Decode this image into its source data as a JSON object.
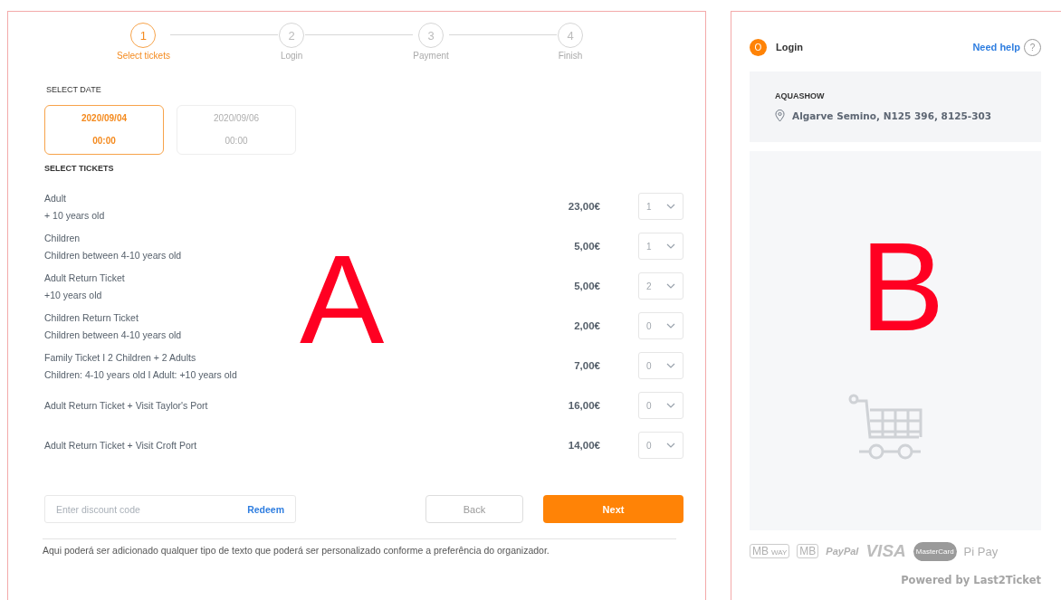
{
  "steps": [
    {
      "number": "1",
      "label": "Select tickets",
      "selected": true
    },
    {
      "number": "2",
      "label": "Login",
      "selected": false
    },
    {
      "number": "3",
      "label": "Payment",
      "selected": false
    },
    {
      "number": "4",
      "label": "Finish",
      "selected": false
    }
  ],
  "date_section": {
    "title": "SELECT DATE",
    "dates": [
      {
        "date": "2020/09/04",
        "time": "00:00",
        "selected": true
      },
      {
        "date": "2020/09/06",
        "time": "00:00",
        "selected": false
      }
    ]
  },
  "tickets_section": {
    "title": "SELECT TICKETS",
    "tickets": [
      {
        "name": "Adult",
        "description": "+ 10 years old",
        "price": "23,00€",
        "quantity": "1"
      },
      {
        "name": "Children",
        "description": "Children between 4-10 years old",
        "price": "5,00€",
        "quantity": "1"
      },
      {
        "name": "Adult Return Ticket",
        "description": "+10 years old",
        "price": "5,00€",
        "quantity": "2"
      },
      {
        "name": "Children Return Ticket",
        "description": "Children between 4-10 years old",
        "price": "2,00€",
        "quantity": "0"
      },
      {
        "name": "Family Ticket  I  2 Children + 2 Adults",
        "description": "Children: 4-10 years old  I  Adult: +10 years old",
        "price": "7,00€",
        "quantity": "0"
      },
      {
        "name": "Adult Return Ticket + Visit Taylor's Port",
        "price": "16,00€",
        "quantity": "0"
      },
      {
        "name": "Adult Return Ticket + Visit Croft Port",
        "price": "14,00€",
        "quantity": "0"
      }
    ]
  },
  "discount": {
    "placeholder": "Enter discount code",
    "action": "Redeem"
  },
  "buttons": {
    "back": "Back",
    "next": "Next"
  },
  "footer_note": "Aqui poderá ser adicionado qualquer tipo de texto que poderá ser personalizado conforme a preferência do organizador.",
  "sidebar": {
    "avatar_letter": "O",
    "login": "Login",
    "help": "Need help",
    "help_mark": "?",
    "event": {
      "name": "AQUASHOW",
      "address": "Algarve Semino, N125 396, 8125-303"
    },
    "payment_methods": [
      {
        "kind": "mbway",
        "label": "MB",
        "extra": "WAY"
      },
      {
        "kind": "multibanco",
        "label": "MB"
      },
      {
        "kind": "paypal",
        "label": "PayPal"
      },
      {
        "kind": "visa",
        "label": "VISA"
      },
      {
        "kind": "mastercard",
        "label": "MasterCard"
      },
      {
        "kind": "pipay",
        "label": "Pi Pay"
      }
    ],
    "powered_by": "Powered by Last2Ticket"
  },
  "panel_labels": [
    {
      "label": "A"
    },
    {
      "label": "B"
    }
  ]
}
